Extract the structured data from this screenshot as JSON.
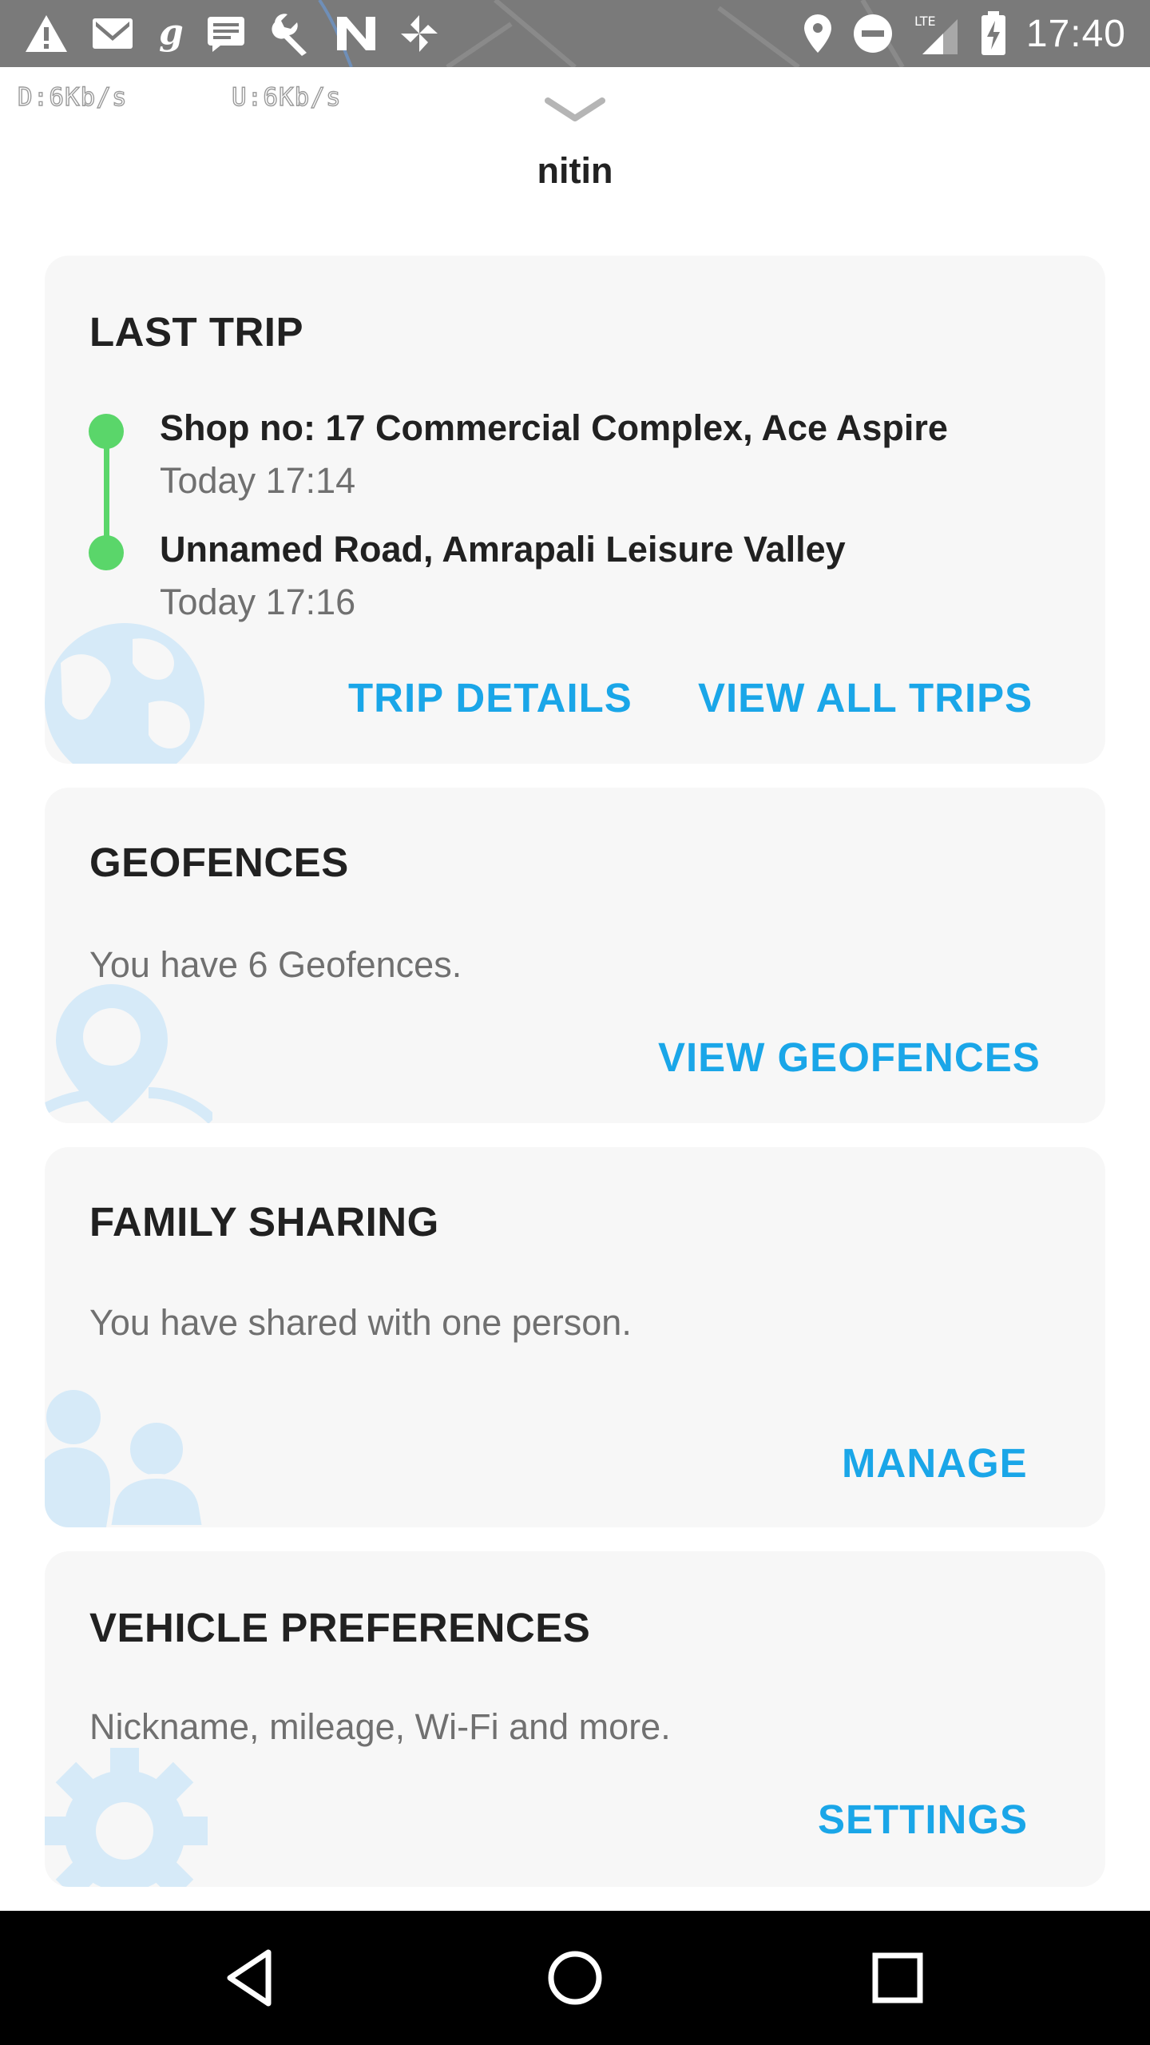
{
  "status_bar": {
    "time": "17:40",
    "left_icons": [
      "warning-icon",
      "gmail-icon",
      "g-app-icon",
      "message-icon",
      "wrench-icon",
      "n-app-icon",
      "pinwheel-icon"
    ],
    "right_icons": [
      "location-pin-icon",
      "do-not-disturb-icon",
      "lte-signal-icon",
      "battery-charging-icon"
    ],
    "network_label": "LTE"
  },
  "net_speed": {
    "download": "D:6Kb/s",
    "upload": "U:6Kb/s"
  },
  "header": {
    "username": "nitin"
  },
  "last_trip": {
    "title": "LAST TRIP",
    "start": {
      "address": "Shop no: 17 Commercial Complex, Ace Aspire",
      "time": "Today 17:14"
    },
    "end": {
      "address": "Unnamed Road, Amrapali Leisure Valley",
      "time": "Today 17:16"
    },
    "action_details": "TRIP DETAILS",
    "action_all": "VIEW ALL TRIPS",
    "decoration_icon": "globe-icon"
  },
  "geofences": {
    "title": "GEOFENCES",
    "text": "You have 6 Geofences.",
    "action": "VIEW GEOFENCES",
    "decoration_icon": "map-pin-icon"
  },
  "family_sharing": {
    "title": "FAMILY SHARING",
    "text": "You have shared with one person.",
    "action": "MANAGE",
    "decoration_icon": "people-icon"
  },
  "vehicle_preferences": {
    "title": "VEHICLE PREFERENCES",
    "text": "Nickname, mileage, Wi-Fi and more.",
    "action": "SETTINGS",
    "decoration_icon": "gear-icon"
  },
  "nav_bar": {
    "buttons": [
      "back-icon",
      "home-icon",
      "recents-icon"
    ]
  },
  "colors": {
    "accent": "#1aa6e8",
    "trip_line": "#5ad66a",
    "card_background": "#f7f7f7",
    "decoration": "#d6eaf8",
    "status_bar": "#7a7a7a"
  }
}
